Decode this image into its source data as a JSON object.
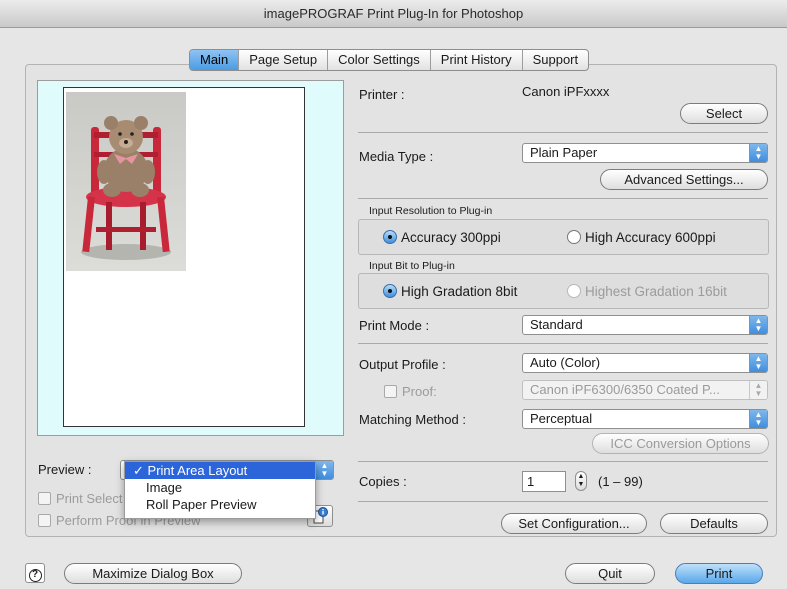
{
  "window": {
    "title": "imagePROGRAF Print Plug-In for Photoshop"
  },
  "tabs": [
    {
      "label": "Main",
      "active": true
    },
    {
      "label": "Page Setup"
    },
    {
      "label": "Color Settings"
    },
    {
      "label": "Print History"
    },
    {
      "label": "Support"
    }
  ],
  "printer": {
    "label": "Printer :",
    "value": "Canon iPFxxxx",
    "select_button": "Select"
  },
  "media": {
    "label": "Media Type :",
    "value": "Plain Paper",
    "advanced_button": "Advanced Settings..."
  },
  "input_resolution": {
    "group_label": "Input Resolution to Plug-in",
    "option1": "Accuracy 300ppi",
    "option2": "High Accuracy 600ppi",
    "selected": "option1"
  },
  "input_bit": {
    "group_label": "Input Bit to Plug-in",
    "option1": "High Gradation 8bit",
    "option2": "Highest Gradation 16bit",
    "selected": "option1"
  },
  "print_mode": {
    "label": "Print Mode :",
    "value": "Standard"
  },
  "output_profile": {
    "label": "Output Profile :",
    "value": "Auto (Color)"
  },
  "proof": {
    "label": "Proof:",
    "value": "Canon iPF6300/6350 Coated P...",
    "checked": false
  },
  "matching": {
    "label": "Matching Method :",
    "value": "Perceptual",
    "icc_button": "ICC Conversion Options"
  },
  "copies": {
    "label": "Copies :",
    "value": "1",
    "range": "(1 – 99)"
  },
  "buttons": {
    "set_configuration": "Set Configuration...",
    "defaults": "Defaults",
    "maximize": "Maximize Dialog Box",
    "quit": "Quit",
    "print": "Print"
  },
  "preview": {
    "label": "Preview :",
    "options": [
      "Print Area Layout",
      "Image",
      "Roll Paper Preview"
    ],
    "selected": "Print Area Layout",
    "checkmark": "✓",
    "print_select_label": "Print Select",
    "perform_proof_label": "Perform Proof in Preview"
  },
  "colors": {
    "accent": "#4b9be2",
    "preview_bg": "#e0fbfb",
    "chair": "#c8283a",
    "menu_highlight": "#2b65d9"
  }
}
